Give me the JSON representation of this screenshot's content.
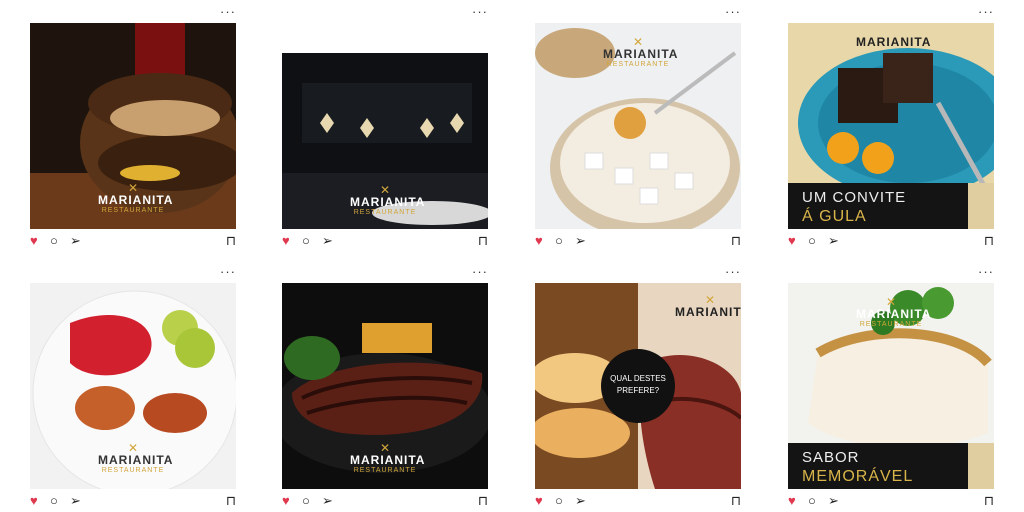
{
  "posts": [
    {
      "logo": {
        "name": "MARIANITA",
        "sub": "RESTAURANTE"
      }
    },
    {
      "logo": {
        "name": "MARIANITA",
        "sub": "RESTAURANTE"
      }
    },
    {
      "logo": {
        "name": "MARIANITA",
        "sub": "RESTAURANTE"
      }
    },
    {
      "logo": {
        "name": "MARIANITA"
      },
      "banner": {
        "line1": "UM CONVITE",
        "line2": "Á GULA"
      }
    },
    {
      "logo": {
        "name": "MARIANITA",
        "sub": "RESTAURANTE"
      }
    },
    {
      "logo": {
        "name": "MARIANITA",
        "sub": "RESTAURANTE"
      }
    },
    {
      "logo": {
        "name": "MARIANITA"
      },
      "question": {
        "line1": "QUAL DESTES",
        "line2": "PREFERE?"
      }
    },
    {
      "logo": {
        "name": "MARIANITA",
        "sub": "RESTAURANTE"
      },
      "banner": {
        "line1": "SABOR",
        "line2": "MEMORÁVEL"
      }
    }
  ],
  "icons": {
    "more": "more-dots-icon",
    "like": "heart-icon",
    "comment": "comment-icon",
    "share": "send-icon",
    "save": "bookmark-icon"
  },
  "colors": {
    "like": "#e0384f",
    "brand_gold": "#d2a63b",
    "banner_bg": "#141414"
  }
}
